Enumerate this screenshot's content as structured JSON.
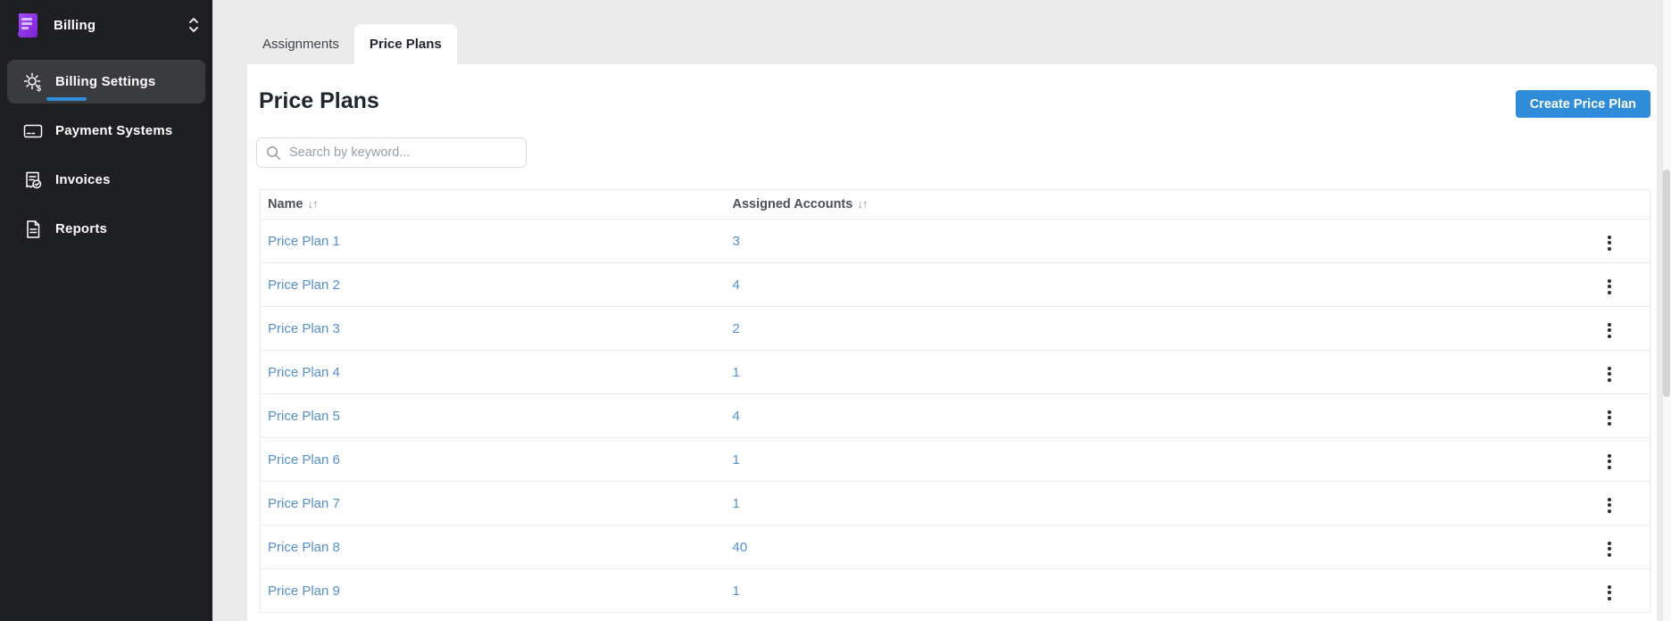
{
  "sidebar": {
    "app_label": "Billing",
    "items": [
      {
        "label": "Billing Settings",
        "icon": "gear-dollar-icon",
        "active": true
      },
      {
        "label": "Payment Systems",
        "icon": "credit-card-icon",
        "active": false
      },
      {
        "label": "Invoices",
        "icon": "invoice-check-icon",
        "active": false
      },
      {
        "label": "Reports",
        "icon": "report-document-icon",
        "active": false
      }
    ]
  },
  "tabs": [
    {
      "label": "Assignments",
      "active": false
    },
    {
      "label": "Price Plans",
      "active": true
    }
  ],
  "page": {
    "title": "Price Plans",
    "create_button": "Create Price Plan"
  },
  "search": {
    "placeholder": "Search by keyword..."
  },
  "table": {
    "sort_glyph": "↓↑",
    "columns": [
      {
        "label": "Name"
      },
      {
        "label": "Assigned Accounts"
      }
    ],
    "rows": [
      {
        "name": "Price Plan 1",
        "accounts": "3"
      },
      {
        "name": "Price Plan 2",
        "accounts": "4"
      },
      {
        "name": "Price Plan 3",
        "accounts": "2"
      },
      {
        "name": "Price Plan 4",
        "accounts": "1"
      },
      {
        "name": "Price Plan 5",
        "accounts": "4"
      },
      {
        "name": "Price Plan 6",
        "accounts": "1"
      },
      {
        "name": "Price Plan 7",
        "accounts": "1"
      },
      {
        "name": "Price Plan 8",
        "accounts": "40"
      },
      {
        "name": "Price Plan 9",
        "accounts": "1"
      }
    ]
  },
  "colors": {
    "accent_blue": "#2e8cd8",
    "link_blue": "#5590cc",
    "sidebar_bg": "#1e1f22",
    "sidebar_active_bg": "#3a3b3f",
    "main_bg": "#ebebeb",
    "logo_purple": "#8c2ff0"
  }
}
